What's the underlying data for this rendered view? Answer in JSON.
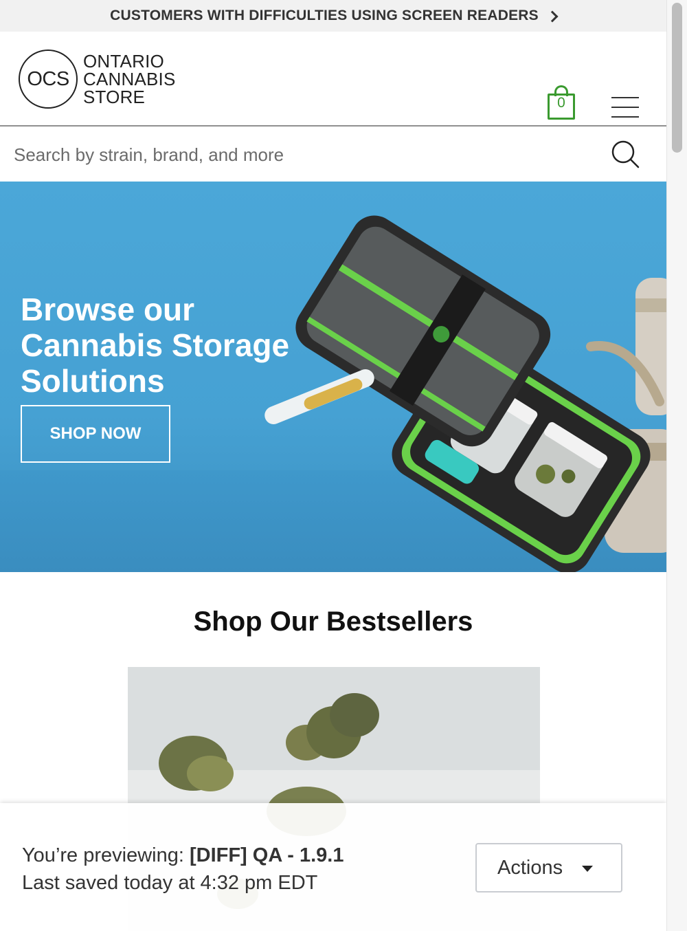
{
  "banner": {
    "text": "CUSTOMERS WITH DIFFICULTIES USING SCREEN READERS"
  },
  "header": {
    "logo_mark": "OCS",
    "logo_lines": [
      "ONTARIO",
      "CANNABIS",
      "STORE"
    ],
    "cart_count": "0",
    "cart_color": "#3a9a2f"
  },
  "search": {
    "placeholder": "Search by strain, brand, and more"
  },
  "hero": {
    "headline": "Browse our Cannabis Storage Solutions",
    "cta_label": "SHOP NOW",
    "background_color": "#47a3d5"
  },
  "bestsellers": {
    "title": "Shop Our Bestsellers"
  },
  "preview": {
    "prefix": "You’re previewing: ",
    "name": "[DIFF] QA - 1.9.1",
    "saved": "Last saved today at 4:32 pm EDT",
    "actions_label": "Actions"
  }
}
